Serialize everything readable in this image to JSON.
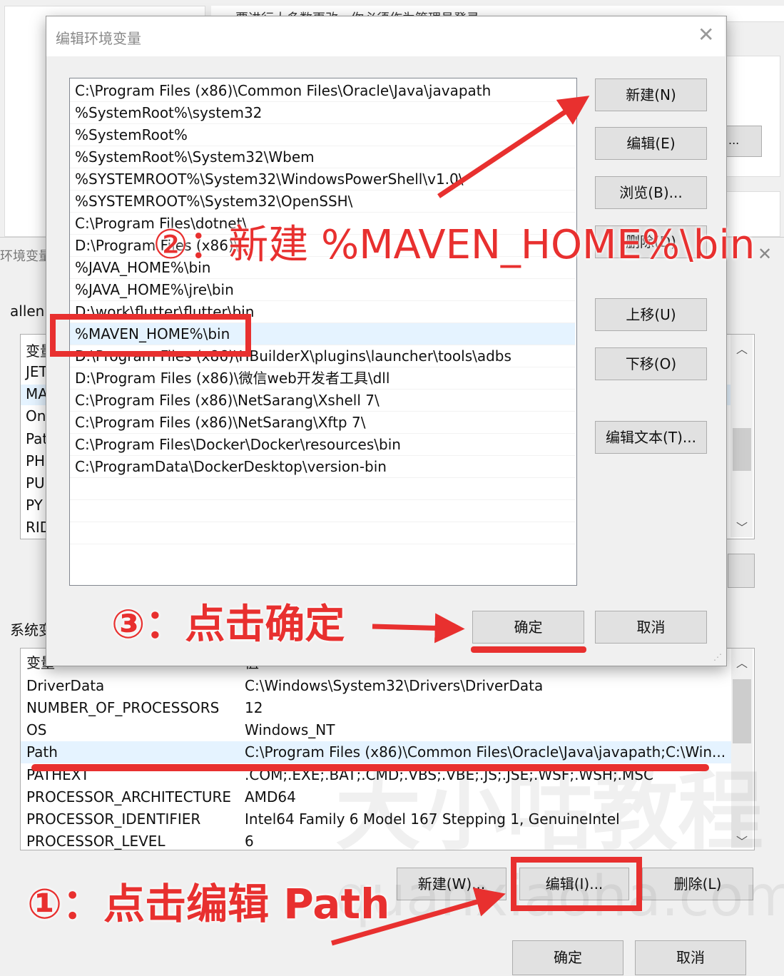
{
  "background": {
    "top_hint": "要进行大多数更改，你必须作为管理员登录",
    "right_button": "...",
    "env_title": "环境变量",
    "user_label": "allen",
    "user_vars_header": "变量",
    "user_vars_rows": [
      "JET",
      "MA",
      "On",
      "Pat",
      "PH",
      "PU",
      "PY",
      "RID"
    ],
    "system_label": "系统变量",
    "system_columns": [
      "变量",
      "值"
    ],
    "system_rows": [
      {
        "name": "DriverData",
        "value": "C:\\Windows\\System32\\Drivers\\DriverData"
      },
      {
        "name": "NUMBER_OF_PROCESSORS",
        "value": "12"
      },
      {
        "name": "OS",
        "value": "Windows_NT"
      },
      {
        "name": "Path",
        "value": "C:\\Program Files (x86)\\Common Files\\Oracle\\Java\\javapath;C:\\Win..."
      },
      {
        "name": "PATHEXT",
        "value": ".COM;.EXE;.BAT;.CMD;.VBS;.VBE;.JS;.JSE;.WSF;.WSH;.MSC"
      },
      {
        "name": "PROCESSOR_ARCHITECTURE",
        "value": "AMD64"
      },
      {
        "name": "PROCESSOR_IDENTIFIER",
        "value": "Intel64 Family 6 Model 167 Stepping 1, GenuineIntel"
      },
      {
        "name": "PROCESSOR_LEVEL",
        "value": "6"
      }
    ],
    "system_buttons": {
      "new": "新建(W)...",
      "edit": "编辑(I)...",
      "delete": "删除(L)"
    },
    "bottom_buttons": {
      "ok": "确定",
      "cancel": "取消"
    }
  },
  "dialog": {
    "title": "编辑环境变量",
    "close_glyph": "✕",
    "paths": [
      "C:\\Program Files (x86)\\Common Files\\Oracle\\Java\\javapath",
      "%SystemRoot%\\system32",
      "%SystemRoot%",
      "%SystemRoot%\\System32\\Wbem",
      "%SYSTEMROOT%\\System32\\WindowsPowerShell\\v1.0\\",
      "%SYSTEMROOT%\\System32\\OpenSSH\\",
      "C:\\Program Files\\dotnet\\",
      "D:\\Program Files (x86)\\...",
      "%JAVA_HOME%\\bin",
      "%JAVA_HOME%\\jre\\bin",
      "D:\\work\\flutter\\flutter\\bin",
      "%MAVEN_HOME%\\bin",
      "D:\\Program Files (x86)\\HBuilderX\\plugins\\launcher\\tools\\adbs",
      "D:\\Program Files (x86)\\微信web开发者工具\\dll",
      "C:\\Program Files (x86)\\NetSarang\\Xshell 7\\",
      "C:\\Program Files (x86)\\NetSarang\\Xftp 7\\",
      "C:\\Program Files\\Docker\\Docker\\resources\\bin",
      "C:\\ProgramData\\DockerDesktop\\version-bin",
      "",
      "",
      ""
    ],
    "selected_index": 11,
    "buttons": {
      "new": "新建(N)",
      "edit": "编辑(E)",
      "browse": "浏览(B)...",
      "delete": "删除(D)",
      "move_up": "上移(U)",
      "move_down": "下移(O)",
      "edit_text": "编辑文本(T)...",
      "ok": "确定",
      "cancel": "取消"
    }
  },
  "annotations": {
    "step1": "①：点击编辑 Path",
    "step2": "②：新建 %MAVEN_HOME%\\bin",
    "step3": "③：点击确定",
    "color": "#e8302f"
  },
  "watermark": {
    "line1": "大小咕教程",
    "line2": "quanxiaoha.com"
  }
}
